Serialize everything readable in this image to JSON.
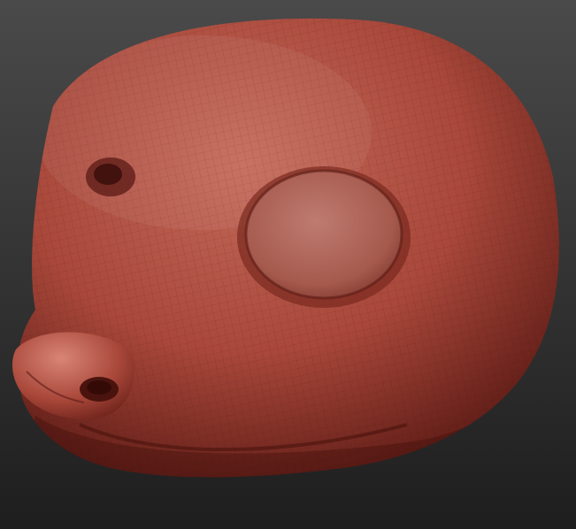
{
  "scene": {
    "subject": "sculpted-animal-head",
    "colors": {
      "background_top": "#4a4a4a",
      "background_bottom": "#1e1e1e",
      "clay_light": "#c46a5a",
      "clay_mid": "#a8473a",
      "clay_dark": "#5a1a14",
      "wire": "#3a0c08"
    }
  }
}
